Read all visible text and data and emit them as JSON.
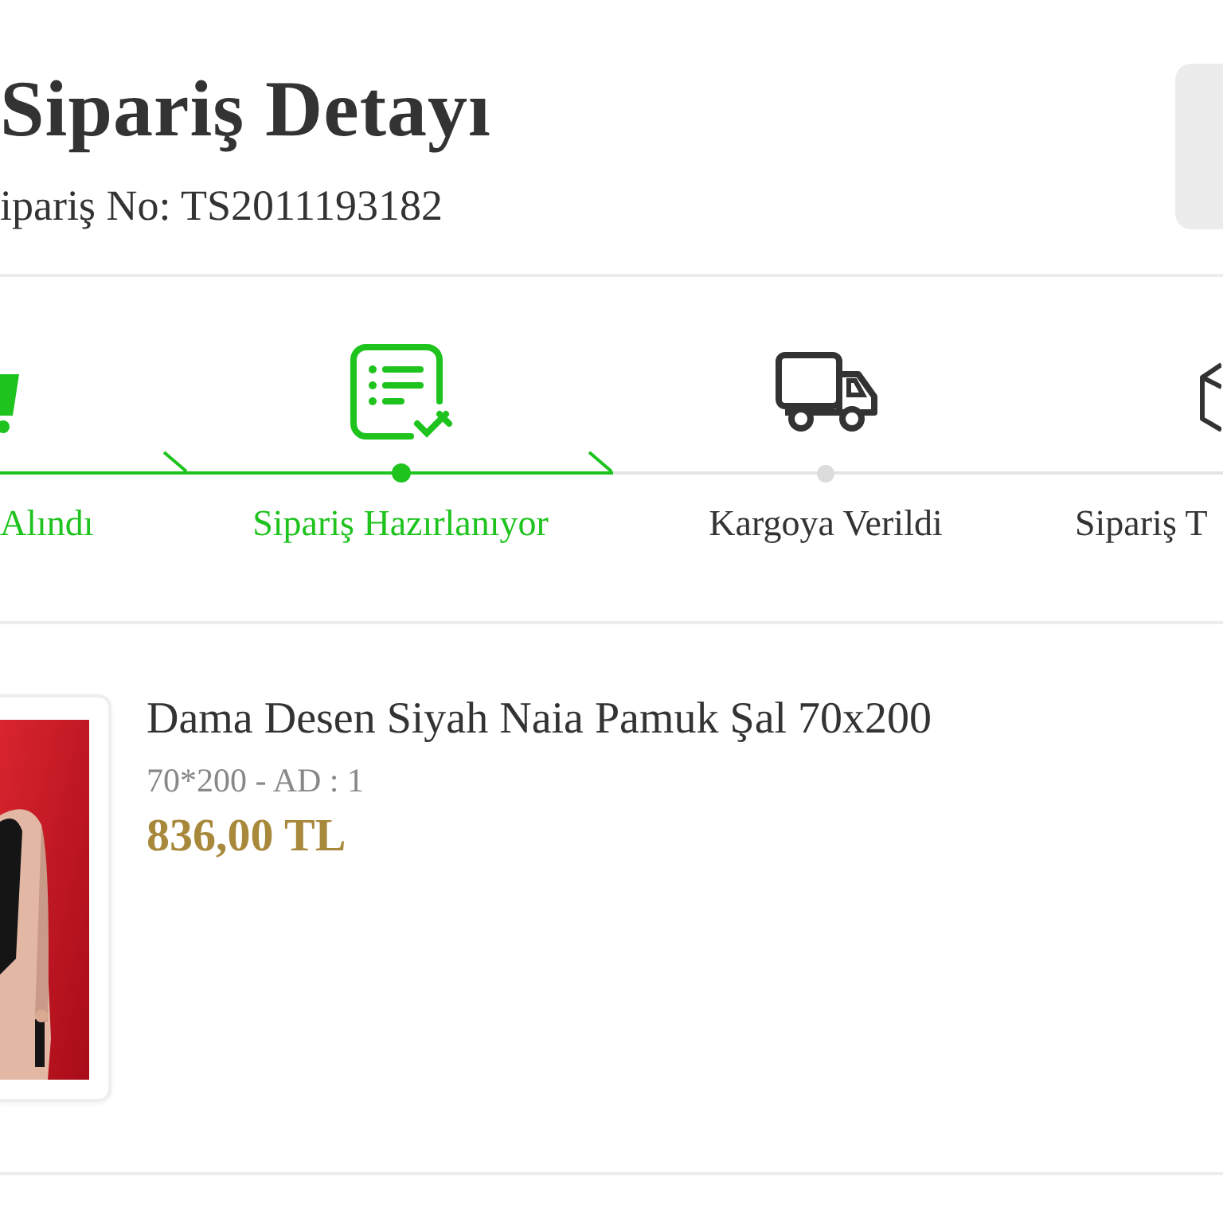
{
  "header": {
    "title": "Sipariş Detayı",
    "order_number": "ipariş No: TS2011193182"
  },
  "steps": [
    {
      "label": "Alındı",
      "done": true
    },
    {
      "label": "Sipariş Hazırlanıyor",
      "done": true
    },
    {
      "label": "Kargoya Verildi",
      "done": false
    },
    {
      "label": "Sipariş T",
      "done": false
    }
  ],
  "product": {
    "name": "Dama Desen Siyah Naia Pamuk Şal 70x200",
    "variant": "70*200 - AD : 1",
    "price": "836,00 TL"
  }
}
